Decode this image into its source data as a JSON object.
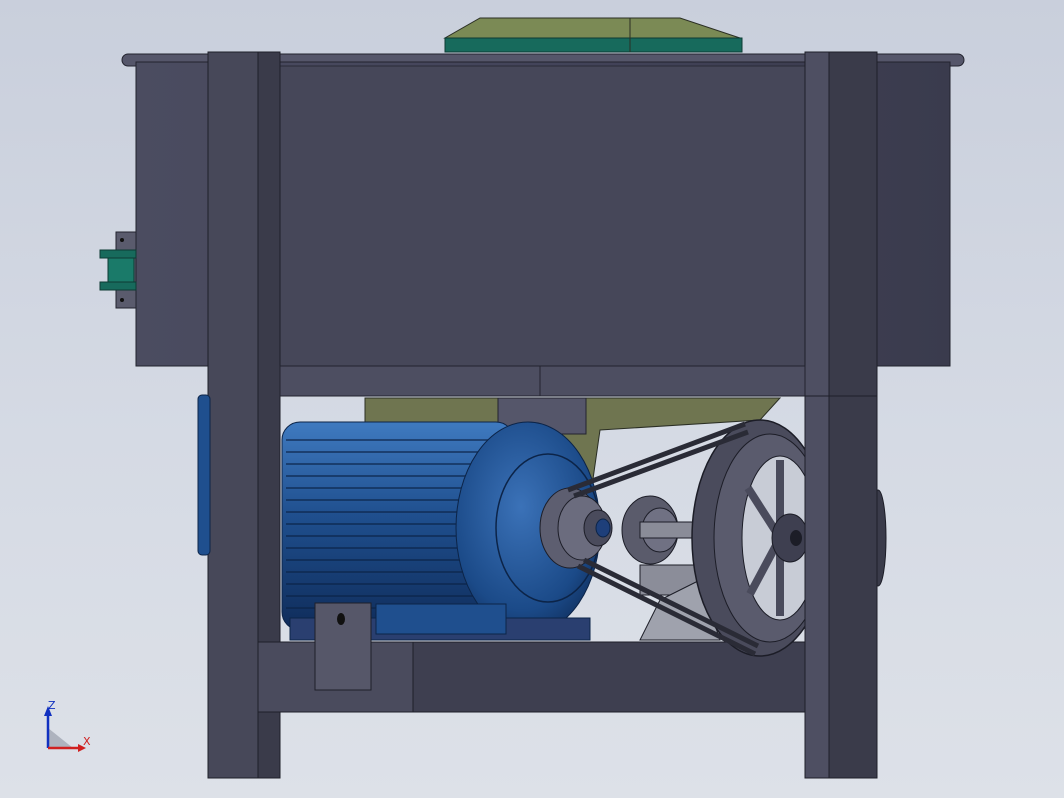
{
  "viewport": {
    "background_top": "#c9cfdc",
    "background_bottom": "#dde1e8"
  },
  "model": {
    "tank_color": "#45465a",
    "frame_color": "#3d3e4e",
    "motor_color": "#1f4f8e",
    "hopper_top_color": "#7b8a55",
    "hopper_band_color": "#176a5c"
  },
  "triad": {
    "x_label": "X",
    "z_label": "Z",
    "x_color": "#d02020",
    "z_color": "#1030c0"
  }
}
